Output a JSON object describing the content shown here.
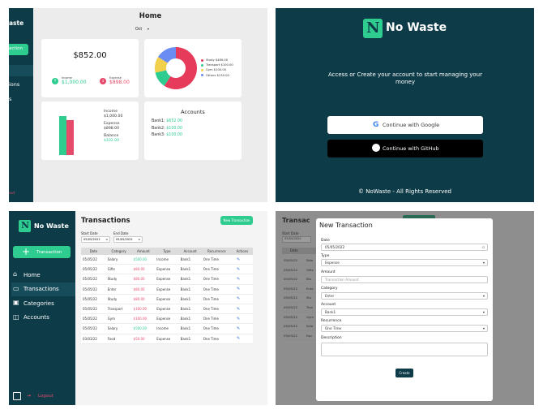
{
  "dashboard": {
    "brand_fragment": "aste",
    "add_fragment": "action",
    "nav_fragments": [
      "ions",
      "s"
    ],
    "logout_fragment": "out",
    "title": "Home",
    "month": "Oct",
    "balance": "$852.00",
    "income_label": "Income",
    "income_value": "$1,000.00",
    "expense_label": "Expense",
    "expense_value": "$898.00",
    "legend": [
      {
        "label": "Study",
        "value": "$480.00",
        "color": "#e63b5a"
      },
      {
        "label": "Transport",
        "value": "$100.00",
        "color": "#2ecc8f"
      },
      {
        "label": "Gym",
        "value": "$100.00",
        "color": "#f2d04c"
      },
      {
        "label": "Others",
        "value": "$130.00",
        "color": "#6b8cf2"
      }
    ],
    "pie_values": [
      480,
      100,
      100,
      130
    ],
    "summary": {
      "income_label": "Income",
      "income_value": "$1,000.00",
      "expense_label": "Expense",
      "expense_value": "$898.00",
      "balance_label": "Balance",
      "balance_value": "$102.00"
    },
    "bar_values": [
      1000,
      898
    ],
    "accounts_title": "Accounts",
    "accounts": [
      {
        "label": "Bank1:",
        "value": "$652.00"
      },
      {
        "label": "Bank2:",
        "value": "$100.00"
      },
      {
        "label": "Bank3:",
        "value": "$100.00"
      }
    ]
  },
  "login": {
    "logo_letter": "N",
    "app_name": "No Waste",
    "tagline": "Access or Create your account to start managing your money",
    "google_button": "Continue with Google",
    "github_button": "Continue with GitHub",
    "footer": "© NoWaste - All Rights Reserved"
  },
  "transactions": {
    "logo_letter": "N",
    "app_name": "No Waste",
    "add_button": "Transaction",
    "nav": [
      {
        "label": "Home",
        "icon": "home-icon"
      },
      {
        "label": "Transactions",
        "icon": "card-icon"
      },
      {
        "label": "Categories",
        "icon": "category-icon"
      },
      {
        "label": "Accounts",
        "icon": "accounts-icon"
      }
    ],
    "logout": "Logout",
    "title": "Transactions",
    "new_button": "New Transaction",
    "start_label": "Start Date",
    "start_value": "05/05/2022",
    "end_label": "End Date",
    "end_value": "05/05/2022",
    "columns": [
      "Date",
      "Category",
      "Amount",
      "Type",
      "Account",
      "Recurrence",
      "Actions"
    ],
    "rows": [
      [
        "05/05/22",
        "Salary",
        "$500.00",
        "Income",
        "Bank1",
        "One Time"
      ],
      [
        "05/05/22",
        "Gifts",
        "$80.00",
        "Expense",
        "Bank1",
        "One Time"
      ],
      [
        "05/05/22",
        "Study",
        "$80.00",
        "Expense",
        "Bank1",
        "One Time"
      ],
      [
        "05/05/22",
        "Enter",
        "$80.00",
        "Expense",
        "Bank1",
        "One Time"
      ],
      [
        "05/05/22",
        "Study",
        "$80.00",
        "Expense",
        "Bank1",
        "One Time"
      ],
      [
        "05/05/22",
        "Transport",
        "$100.00",
        "Expense",
        "Bank1",
        "One Time"
      ],
      [
        "05/05/22",
        "Gym",
        "$100.00",
        "Expense",
        "Bank1",
        "One Time"
      ],
      [
        "05/05/22",
        "Salary",
        "$500.00",
        "Income",
        "Bank1",
        "One Time"
      ],
      [
        "03/03/22",
        "Food",
        "$50.00",
        "Expense",
        "Bank1",
        "One Time"
      ]
    ]
  },
  "modal": {
    "bg_title_fragment": "Transac",
    "bg_start_label": "Start Date",
    "bg_start_value": "05/05/2022",
    "bg_date_header": "Date",
    "bg_rows": [
      {
        "date": "05/05/22",
        "cat": "Sala"
      },
      {
        "date": "05/05/22",
        "cat": "Gifts"
      },
      {
        "date": "05/05/22",
        "cat": "Stu"
      },
      {
        "date": "05/05/22",
        "cat": "Ente"
      },
      {
        "date": "05/05/22",
        "cat": "Stu"
      },
      {
        "date": "05/05/22",
        "cat": "Tran"
      },
      {
        "date": "05/05/22",
        "cat": "Gym"
      },
      {
        "date": "05/05/22",
        "cat": "Sala"
      },
      {
        "date": "03/03/22",
        "cat": "Foo"
      }
    ],
    "title": "New Transaction",
    "date_label": "Date",
    "date_value": "05/05/2022",
    "type_label": "Type",
    "type_value": "Expense",
    "amount_label": "Amount",
    "amount_placeholder": "Transaction Amount",
    "category_label": "Category",
    "category_value": "Enter",
    "account_label": "Account",
    "account_value": "Bank1",
    "recurrence_label": "Recurrence",
    "recurrence_value": "One Time",
    "description_label": "Description",
    "create_button": "Create"
  },
  "colors": {
    "dark_teal": "#0d3b47",
    "accent_green": "#2ecc8f",
    "expense_red": "#e64a6b"
  }
}
